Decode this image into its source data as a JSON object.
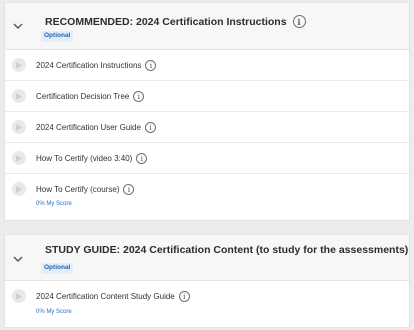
{
  "modules": [
    {
      "title": "RECOMMENDED: 2024 Certification Instructions",
      "badge": "Optional",
      "items": [
        {
          "label": "2024 Certification Instructions",
          "score": null
        },
        {
          "label": "Certification Decision Tree",
          "score": null
        },
        {
          "label": "2024 Certification User Guide",
          "score": null
        },
        {
          "label": "How To Certify (video 3:40)",
          "score": null
        },
        {
          "label": "How To Certify (course)",
          "score": "0% My Score"
        }
      ]
    },
    {
      "title": "STUDY GUIDE: 2024 Certification Content (to study for the assessments)",
      "badge": "Optional",
      "items": [
        {
          "label": "2024 Certification Content Study Guide",
          "score": "0% My Score"
        }
      ]
    }
  ],
  "icons": {
    "collapse": "chevron-down-icon",
    "info": "info-icon",
    "item": "play-icon"
  },
  "colors": {
    "badge_bg": "#e3eefb",
    "badge_text": "#2463b8",
    "score_text": "#2e6fbf",
    "header_bg": "#f7f7f7",
    "page_bg": "#ececec"
  }
}
